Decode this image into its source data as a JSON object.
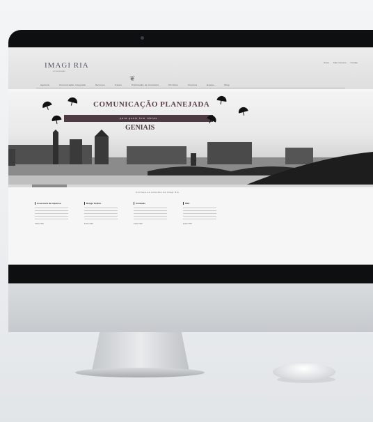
{
  "site": {
    "logo": "IMAGI RIA",
    "logo_sub": "comunicação",
    "top_links": [
      "Home",
      "Fale Conosco",
      "Contato"
    ],
    "nav": [
      "Agência",
      "Comunicação Integrada",
      "Serviços",
      "Cases",
      "Publicação de Conteúdo",
      "Portfólio",
      "Clientes",
      "Equipe",
      "Blog"
    ]
  },
  "hero": {
    "headline": "COMUNICAÇÃO PLANEJADA",
    "ribbon": "para quem tem ideias",
    "subhead": "GENIAIS"
  },
  "section": {
    "title": "Conheça as soluções da Imagi Ria",
    "columns": [
      {
        "title": "Assessoria de imprensa",
        "more": "Leia mais"
      },
      {
        "title": "Design Gráfico",
        "more": "Leia mais"
      },
      {
        "title": "Conteúdo",
        "more": "Leia mais"
      },
      {
        "title": "Web",
        "more": "Leia mais"
      }
    ]
  }
}
